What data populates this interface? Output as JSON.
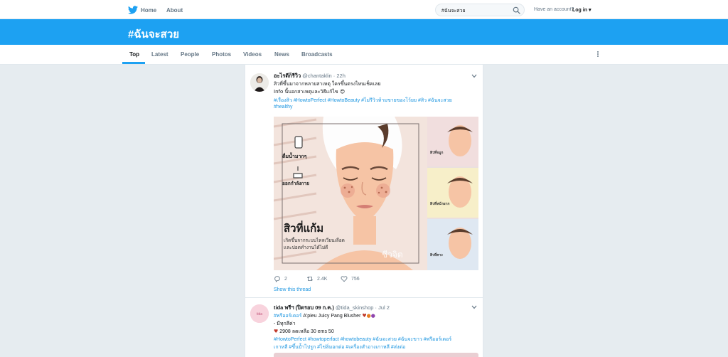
{
  "colors": {
    "brand": "#1da1f2",
    "link": "#1b95e0",
    "background": "#e6ecf0"
  },
  "nav": {
    "home_label": "Home",
    "about_label": "About",
    "search_value": "#ฉันจะสวย",
    "account_prompt": "Have an account?",
    "login_label": "Log in"
  },
  "banner": {
    "title": "#ฉันจะสวย"
  },
  "tabs": [
    {
      "label": "Top",
      "active": true
    },
    {
      "label": "Latest"
    },
    {
      "label": "People"
    },
    {
      "label": "Photos"
    },
    {
      "label": "Videos"
    },
    {
      "label": "News"
    },
    {
      "label": "Broadcasts"
    }
  ],
  "tweets": [
    {
      "name": "อะไรดีก็รีวิว",
      "handle": "@chantaklin",
      "time": "22h",
      "lines": [
        "สิวที่ขึ้นมาจากหลายสาเหตุ ใครขึ้นตรงไหนเช็คเลย",
        "Info นี้บอกสาเหตุและวิธีแก้ไข 😍"
      ],
      "hashtags": [
        "#เรื่องสิว #HowtoPerfect #HowtoBeauty #ไม่รีวิวห้ามขายของโว้ยย #สิว #ฉันจะสวย",
        "#healthy"
      ],
      "image": {
        "label_drink": "ดื่มน้ำมากๆ",
        "label_exercise": "ออกกำลังกาย",
        "headline": "สิวที่แก้ม",
        "caption_1": "เกิดขึ้นจากระบบไหลเวียนเลือด",
        "caption_2": "และปอดทำงานได้ไม่ดี",
        "watermark": "ชีวจิต",
        "side_label_1": "สิวที่จมูก",
        "side_label_2": "สิวที่หน้าผาก",
        "side_label_3": "สิวที่คาง"
      },
      "reply_count": "2",
      "retweet_count": "2.4K",
      "like_count": "756",
      "show_thread": "Show this thread"
    },
    {
      "name": "tida พรีฯ (ปิดรอบ 09 ก.ค.)",
      "handle": "@tida_skinshop",
      "time": "Jul 2",
      "lines": [
        "A'pieu Juicy Pang Blusher",
        "- มีทุกสีค่า",
        "2908 ลดเหลือ 30 ems 50"
      ],
      "preorder_tag": "#พรีออร์เดอร์",
      "hashtags": [
        "#HowtoPerfect #howtoperfact #howtobeauty #ฉันจะสวย #ฉันจะขาว #พรีออร์เดอร์",
        "เกาหลี #ขึ้นป้ำไปรูก #ไข่ลิ่มอกต่อ #เครื่องสำอางเกาหลี #ส่งต่อ"
      ]
    }
  ]
}
